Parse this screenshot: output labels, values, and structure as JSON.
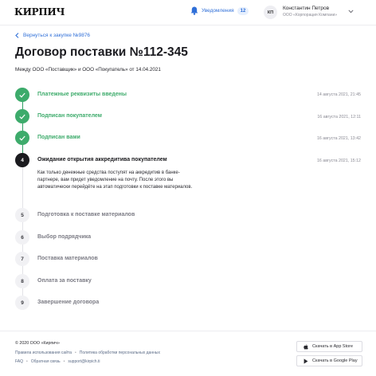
{
  "header": {
    "logo": "КИРПИЧ",
    "notifications_label": "Уведомления",
    "notifications_count": "12",
    "user_initials": "КП",
    "user_name": "Константин Петров",
    "user_org": "ООО «Корпорация Компани»"
  },
  "main": {
    "back_link": "Вернуться к закупке №9876",
    "title": "Договор поставки №112-345",
    "subtitle": "Между ООО «Поставщик» и ООО «Покупатель» от 14.04.2021"
  },
  "steps": [
    {
      "number": "1",
      "label": "Платежные реквизиты введены",
      "date": "14 августа 2021, 21:45",
      "status": "done"
    },
    {
      "number": "2",
      "label": "Подписан покупателем",
      "date": "16 августа 2021, 12:11",
      "status": "done"
    },
    {
      "number": "3",
      "label": "Подписан вами",
      "date": "16 августа 2021, 13:42",
      "status": "done"
    },
    {
      "number": "4",
      "label": "Ожидание открытия аккредитива покупателем",
      "date": "16 августа 2021, 15:12",
      "status": "active",
      "description": "Как только денежные средства поступят на аккредитив в банке-партнере, вам придет уведомление на почту. После этого вы автоматически перейдёте на этап подготовки к поставке материалов."
    },
    {
      "number": "5",
      "label": "Подготовка к поставке материалов",
      "date": "",
      "status": "pending"
    },
    {
      "number": "6",
      "label": "Выбор подрядчика",
      "date": "",
      "status": "pending"
    },
    {
      "number": "7",
      "label": "Поставка материалов",
      "date": "",
      "status": "pending"
    },
    {
      "number": "8",
      "label": "Оплата за поставку",
      "date": "",
      "status": "pending"
    },
    {
      "number": "9",
      "label": "Завершение договора",
      "date": "",
      "status": "pending"
    }
  ],
  "footer": {
    "copyright": "© 2020 ООО «Кирпич»",
    "terms": "Правила использования сайта",
    "privacy": "Политика обработки персональных данных",
    "faq": "FAQ",
    "feedback": "Обратная связь",
    "email": "support@kirpich.ti",
    "app_store": "Скачать в App Store",
    "google_play": "Скачать в Google Play"
  },
  "colors": {
    "accent": "#2f6fd8",
    "done": "#3dab6b",
    "active": "#1b1b1f",
    "pending": "#7d7d86"
  }
}
